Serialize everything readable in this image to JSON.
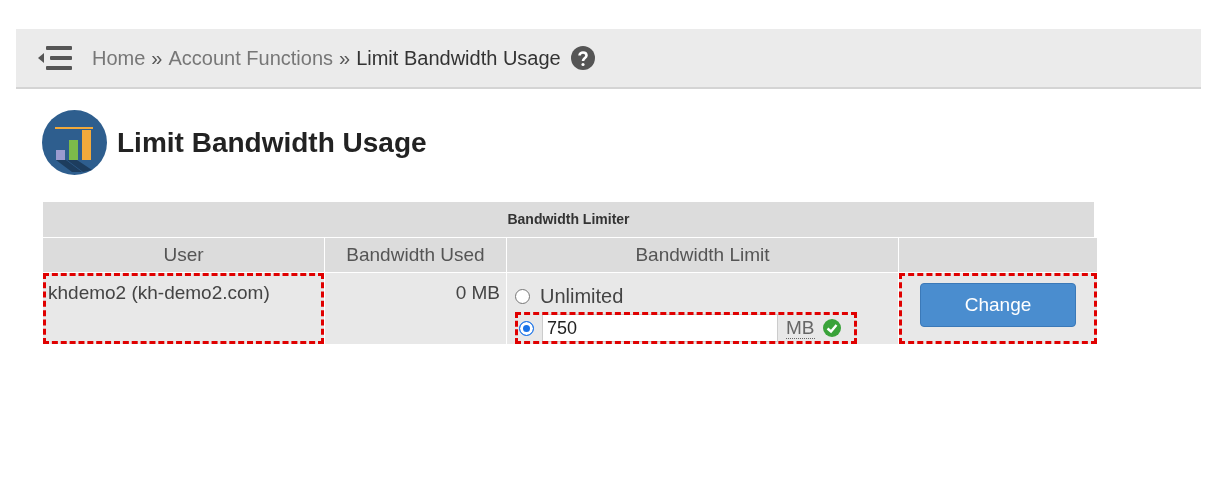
{
  "breadcrumb": [
    {
      "label": "Home",
      "current": false
    },
    {
      "label": "Account Functions",
      "current": false
    },
    {
      "label": "Limit Bandwidth Usage",
      "current": true
    }
  ],
  "separator": "»",
  "page_title": "Limit Bandwidth Usage",
  "table": {
    "caption": "Bandwidth Limiter",
    "columns": [
      "User",
      "Bandwidth Used",
      "Bandwidth Limit"
    ],
    "row": {
      "user": "khdemo2 (kh-demo2.com)",
      "user_highlighted": true,
      "used": "0 MB",
      "options": [
        {
          "kind": "plain",
          "label": "Unlimited",
          "selected": false,
          "highlighted": false
        },
        {
          "kind": "amount",
          "value": "750",
          "unit": "MB",
          "valid": true,
          "selected": true,
          "highlighted": true
        }
      ],
      "button": "Change",
      "button_highlighted": true
    }
  }
}
